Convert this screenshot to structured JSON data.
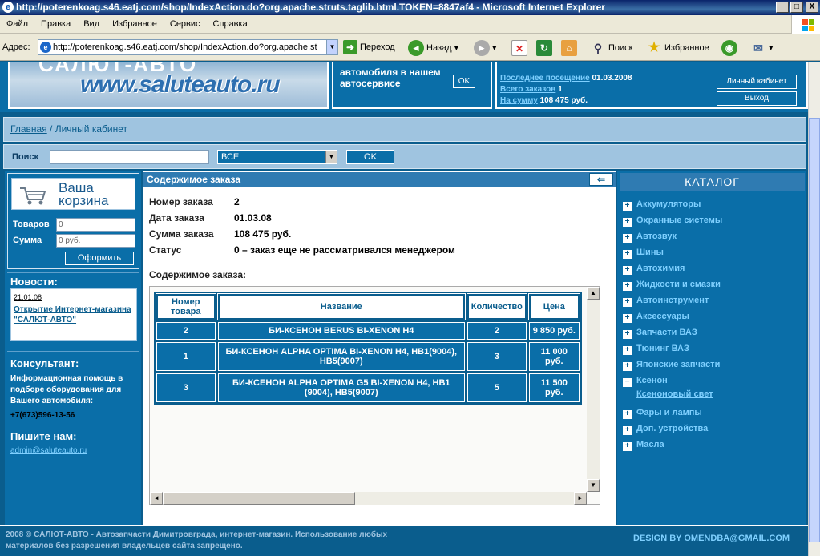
{
  "window": {
    "title": "http://poterenkoag.s46.eatj.com/shop/IndexAction.do?org.apache.struts.taglib.html.TOKEN=8847af4 - Microsoft Internet Explorer",
    "minimize": "_",
    "maximize": "□",
    "close": "X"
  },
  "menu": [
    "Файл",
    "Правка",
    "Вид",
    "Избранное",
    "Сервис",
    "Справка"
  ],
  "toolbar": {
    "address_label": "Адрес:",
    "address_value": "http://poterenkoag.s46.eatj.com/shop/IndexAction.do?org.apache.st",
    "go_label": "Переход",
    "back_label": "Назад",
    "search_label": "Поиск",
    "favorites_label": "Избранное"
  },
  "header": {
    "logo_text": "www.saluteauto.ru",
    "logo_top_text": "САЛЮТ-АВТО",
    "promo_line1": "автомобиля в нашем",
    "promo_line2": "автосервисе",
    "promo_ok": "OK",
    "last_visit_label": "Последнее посещение",
    "last_visit_value": "01.03.2008",
    "orders_total_label": "Всего заказов",
    "orders_total_value": "1",
    "sum_label": "На сумму",
    "sum_value": "108 475 руб.",
    "cabinet_button": "Личный кабинет",
    "logout_button": "Выход"
  },
  "breadcrumb": {
    "home": "Главная",
    "separator": " / ",
    "current": "Личный кабинет"
  },
  "search": {
    "label": "Поиск",
    "value": "",
    "select_value": "ВСЕ",
    "ok": "OK"
  },
  "cart": {
    "title": "Ваша корзина",
    "items_label": "Товаров",
    "items_value": "0",
    "sum_label": "Сумма",
    "sum_value": "0 руб.",
    "checkout": "Оформить"
  },
  "news": {
    "title": "Новости:",
    "date": "21.01.08",
    "link": "Открытие Интернет-магазина \"САЛЮТ-АВТО\""
  },
  "consultant": {
    "title": "Консультант:",
    "text": "Информационная помощь в подборе оборудования для Вашего автомобиля:",
    "phone": "+7(673)596-13-56"
  },
  "contact": {
    "title": "Пишите нам:",
    "email": "admin@saluteauto.ru"
  },
  "order": {
    "panel_title": "Содержимое заказа",
    "number_label": "Номер заказа",
    "number_value": "2",
    "date_label": "Дата заказа",
    "date_value": "01.03.08",
    "sum_label": "Сумма заказа",
    "sum_value": "108 475 руб.",
    "status_label": "Статус",
    "status_value": "0 – заказ еще не рассматривался менеджером",
    "contents_label": "Содержимое заказа:",
    "columns": [
      "Номер товара",
      "Название",
      "Количество",
      "Цена"
    ],
    "rows": [
      [
        "2",
        "БИ-КСЕНОН BERUS BI-XENON H4",
        "2",
        "9 850 руб."
      ],
      [
        "1",
        "БИ-КСЕНОН ALPHA OPTIMA BI-XENON H4, HB1(9004), HB5(9007)",
        "3",
        "11 000 руб."
      ],
      [
        "3",
        "БИ-КСЕНОН ALPHA OPTIMA G5 BI-XENON H4, HB1 (9004), HB5(9007)",
        "5",
        "11 500 руб."
      ]
    ]
  },
  "catalog": {
    "title": "КАТАЛОГ",
    "items": [
      {
        "label": "Аккумуляторы",
        "state": "+"
      },
      {
        "label": "Охранные системы",
        "state": "+"
      },
      {
        "label": "Автозвук",
        "state": "+"
      },
      {
        "label": "Шины",
        "state": "+"
      },
      {
        "label": "Автохимия",
        "state": "+"
      },
      {
        "label": "Жидкости и смазки",
        "state": "+"
      },
      {
        "label": "Автоинструмент",
        "state": "+"
      },
      {
        "label": "Аксессуары",
        "state": "+"
      },
      {
        "label": "Запчасти ВАЗ",
        "state": "+"
      },
      {
        "label": "Тюнинг ВАЗ",
        "state": "+"
      },
      {
        "label": "Японские запчасти",
        "state": "+"
      },
      {
        "label": "Ксенон",
        "state": "−",
        "sub": "Ксеноновый свет"
      },
      {
        "label": "Фары и лампы",
        "state": "+"
      },
      {
        "label": "Доп. устройства",
        "state": "+"
      },
      {
        "label": "Масла",
        "state": "+"
      }
    ]
  },
  "footer": {
    "text": "2008 © САЛЮТ-АВТО - Автозапчасти Димитровграда, интернет-магазин. Использование любых материалов без разрешения владельцев сайта запрещено.",
    "design_label": "DESIGN BY",
    "design_email": "OMENDBA@GMAIL.COM"
  },
  "colors": {
    "page_bg": "#0a5d8d",
    "panel_bg": "#0a6ea8",
    "light_bar": "#9fc4e0",
    "link": "#7fd0ff"
  }
}
